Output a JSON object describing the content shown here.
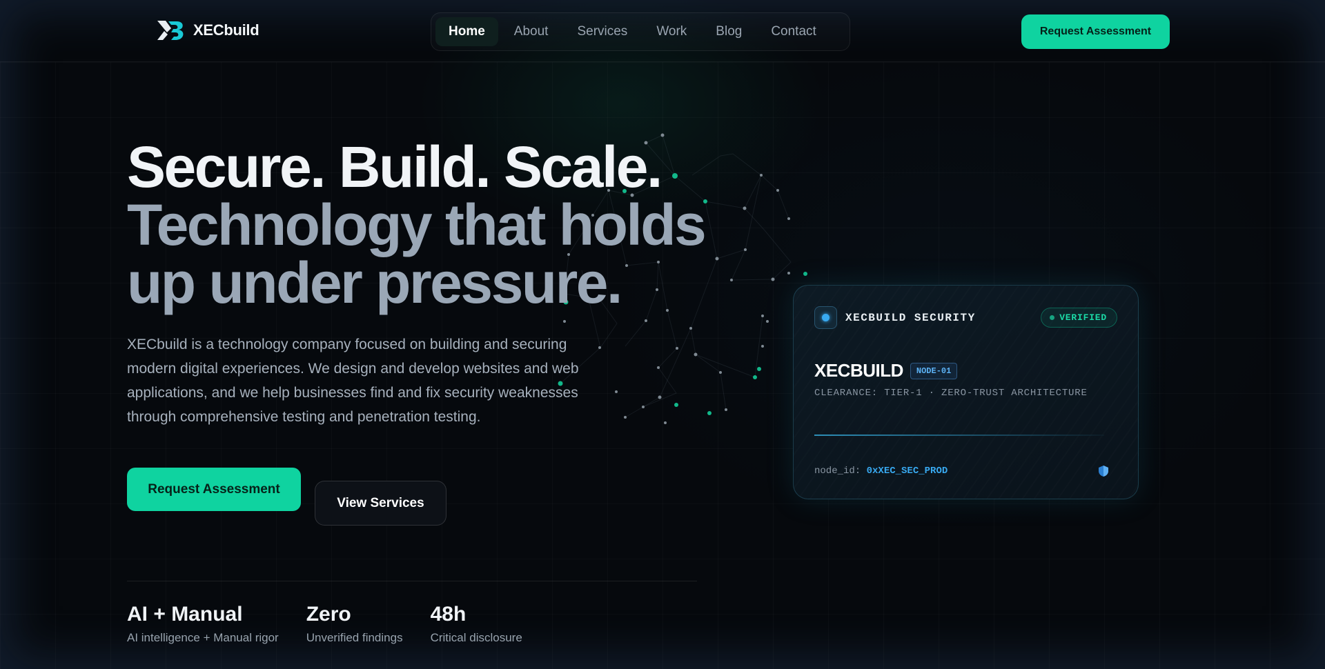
{
  "brand": {
    "name": "XECbuild",
    "logo_icon": "xb-logo-icon"
  },
  "nav": {
    "items": [
      {
        "label": "Home",
        "active": true
      },
      {
        "label": "About",
        "active": false
      },
      {
        "label": "Services",
        "active": false
      },
      {
        "label": "Work",
        "active": false
      },
      {
        "label": "Blog",
        "active": false
      },
      {
        "label": "Contact",
        "active": false
      }
    ],
    "cta_label": "Request Assessment"
  },
  "hero": {
    "title_line1": "Secure. Build. Scale.",
    "title_line2": "Technology that holds up under pressure.",
    "description": "XECbuild is a technology company focused on building and securing modern digital experiences. We design and develop websites and web applications, and we help businesses find and fix security weaknesses through comprehensive testing and penetration testing.",
    "primary_button": "Request Assessment",
    "secondary_button": "View Services"
  },
  "stats": [
    {
      "value": "AI + Manual",
      "label": "AI intelligence + Manual rigor"
    },
    {
      "value": "Zero",
      "label": "Unverified findings"
    },
    {
      "value": "48h",
      "label": "Critical disclosure"
    }
  ],
  "card": {
    "org": "XECBUILD SECURITY",
    "badge": "VERIFIED",
    "name": "XECBUILD",
    "node_tag": "NODE-01",
    "clearance": "CLEARANCE: TIER-1 · ZERO-TRUST ARCHITECTURE",
    "node_key": "node_id:",
    "node_value": "0xXEC_SEC_PROD",
    "shield_icon": "shield-icon"
  },
  "colors": {
    "accent": "#0fd3a0",
    "background": "#06090d",
    "card_blue": "#38a9f0",
    "muted_text": "#9aa7b6"
  }
}
